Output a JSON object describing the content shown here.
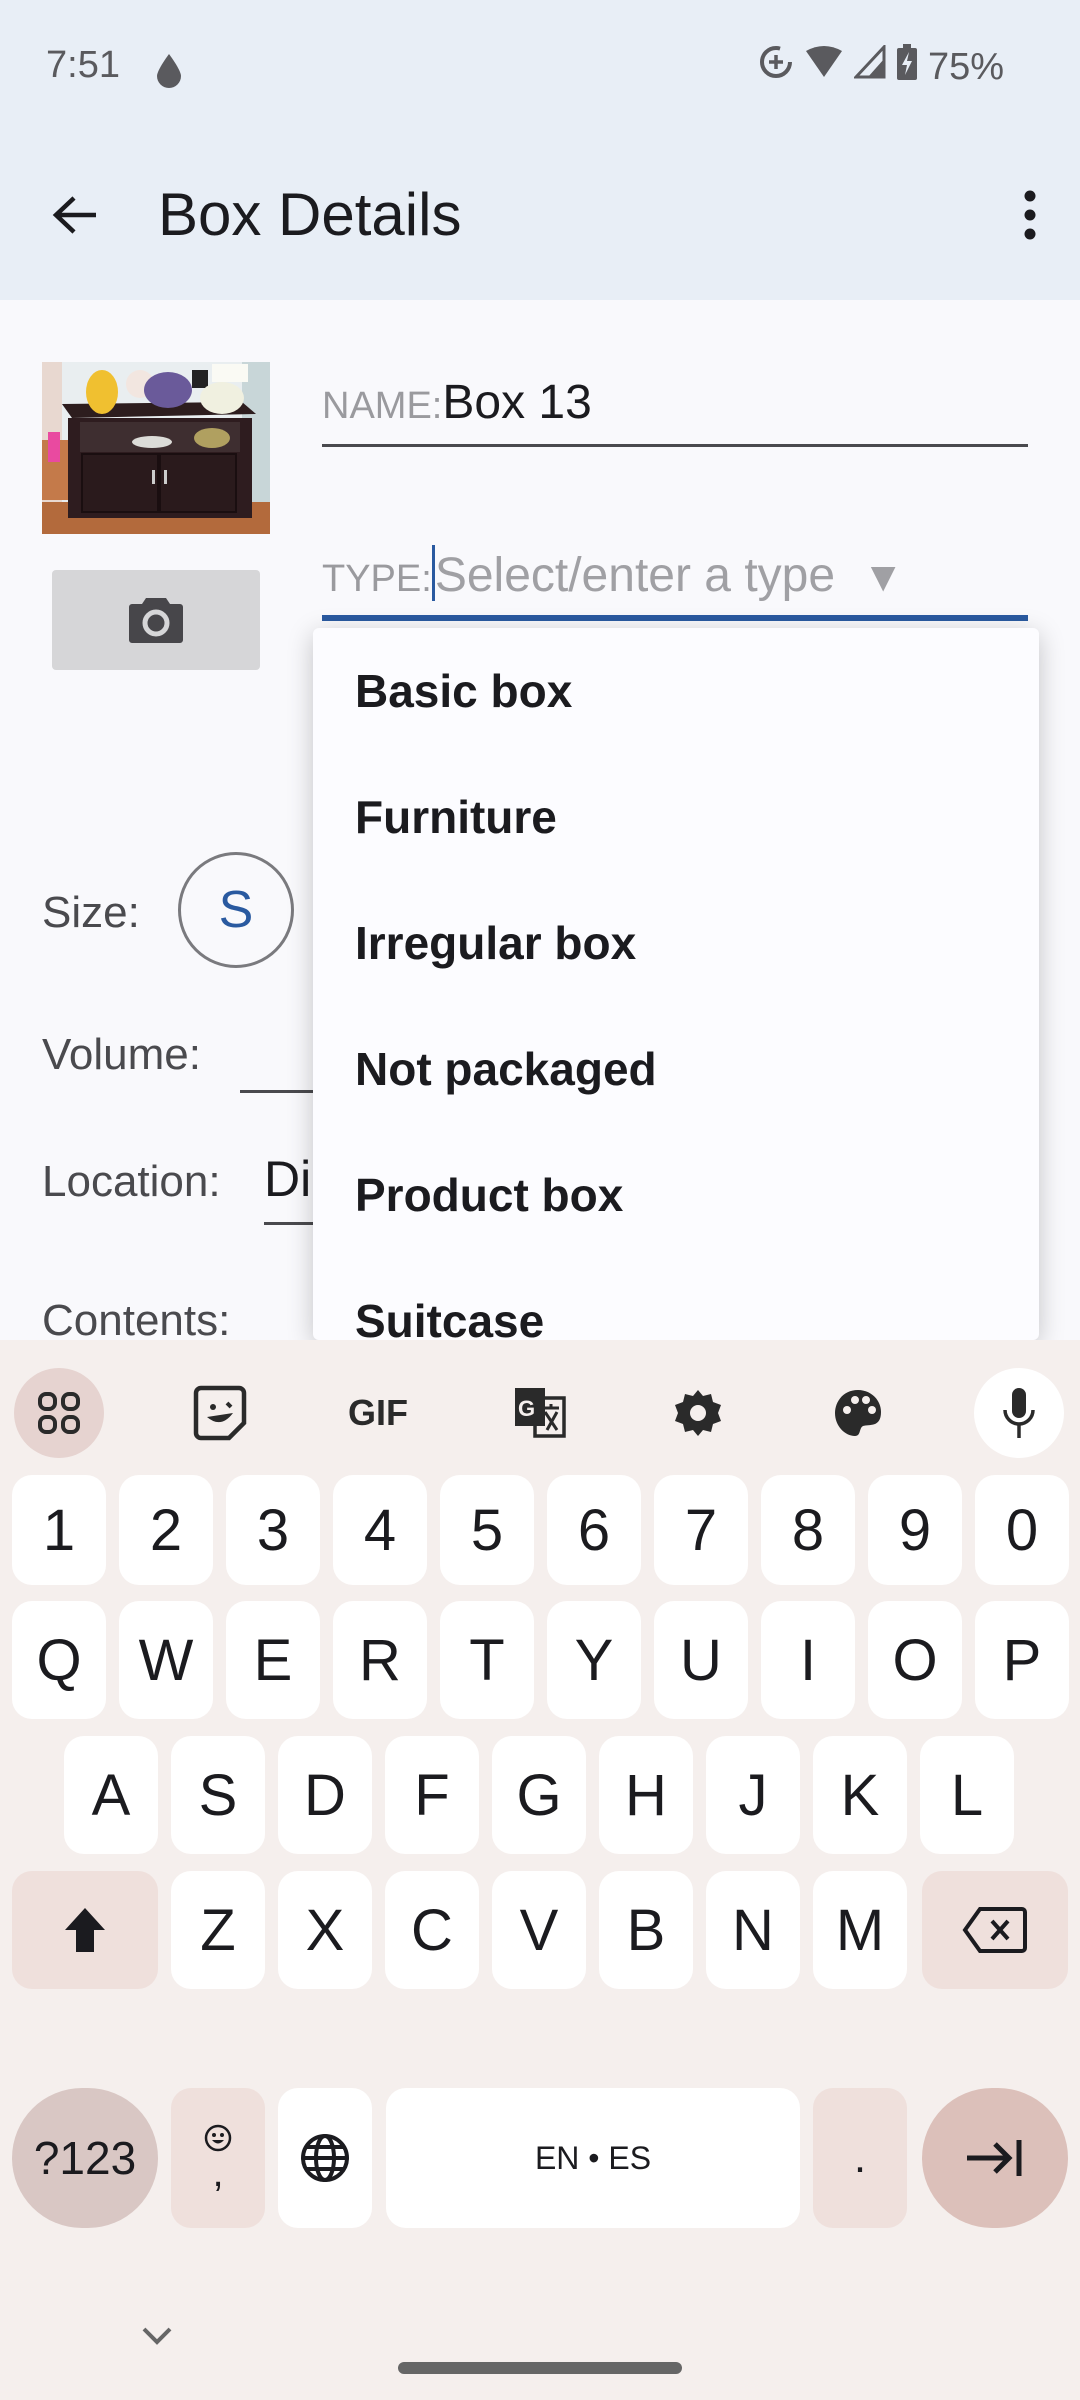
{
  "status_bar": {
    "time": "7:51",
    "battery": "75%",
    "icons": [
      "drop-icon",
      "data-saver-icon",
      "wifi-icon",
      "signal-icon",
      "battery-charging-icon"
    ]
  },
  "app_bar": {
    "title": "Box Details",
    "back_icon": "arrow-back-icon",
    "menu_icon": "more-vert-icon"
  },
  "form": {
    "name_label": "NAME:",
    "name_value": "Box 13",
    "type_label": "TYPE:",
    "type_placeholder": "Select/enter a type",
    "type_arrow": "▼",
    "size_label": "Size:",
    "size_value": "S",
    "volume_label": "Volume:",
    "location_label": "Location:",
    "location_value": "Di",
    "contents_label": "Contents:"
  },
  "type_dropdown": {
    "options": [
      "Basic box",
      "Furniture",
      "Irregular box",
      "Not packaged",
      "Product box",
      "Suitcase"
    ]
  },
  "keyboard": {
    "toolbar": [
      "apps-grid-icon",
      "sticker-icon",
      "GIF",
      "translate-icon",
      "settings-icon",
      "palette-icon",
      "mic-icon"
    ],
    "gif_label": "GIF",
    "row_numbers": [
      "1",
      "2",
      "3",
      "4",
      "5",
      "6",
      "7",
      "8",
      "9",
      "0"
    ],
    "row1": [
      "Q",
      "W",
      "E",
      "R",
      "T",
      "Y",
      "U",
      "I",
      "O",
      "P"
    ],
    "row2": [
      "A",
      "S",
      "D",
      "F",
      "G",
      "H",
      "J",
      "K",
      "L"
    ],
    "row3": [
      "Z",
      "X",
      "C",
      "V",
      "B",
      "N",
      "M"
    ],
    "symbols_label": "?123",
    "comma_label": ",",
    "space_label": "EN • ES",
    "period_label": "."
  },
  "colors": {
    "accent": "#2a5aa0",
    "appbar_bg": "#e8eef6",
    "keyboard_bg": "#f5efed"
  }
}
